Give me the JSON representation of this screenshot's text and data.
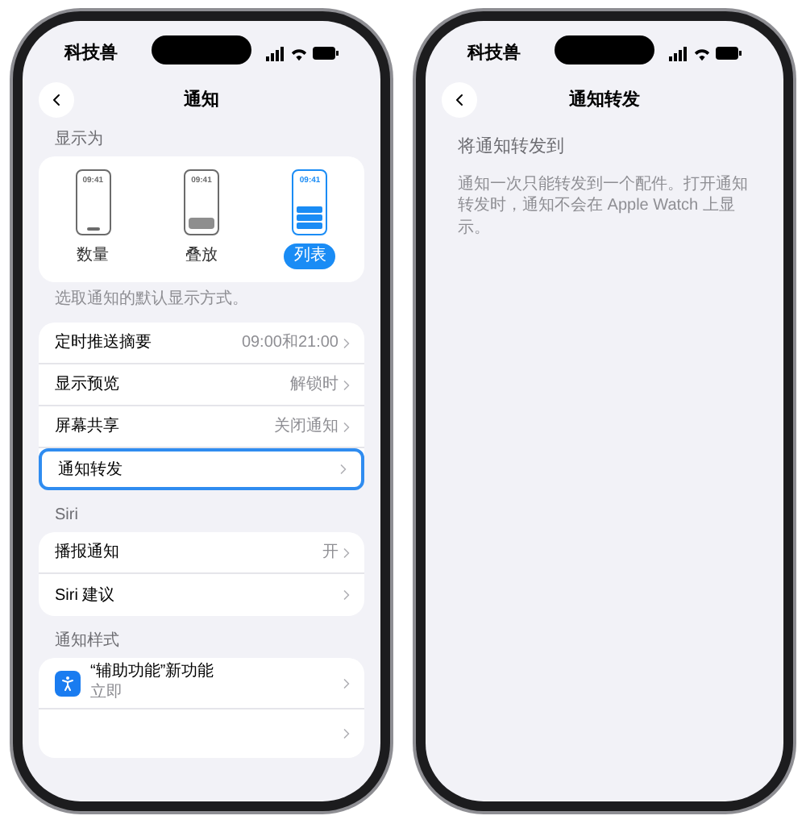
{
  "left_screen": {
    "status_bar": {
      "carrier": "科技兽"
    },
    "title": "通知",
    "display_section": {
      "header": "显示为",
      "options": [
        {
          "label": "数量",
          "clock": "09:41",
          "kind": "count",
          "selected": false
        },
        {
          "label": "叠放",
          "clock": "09:41",
          "kind": "stack",
          "selected": false
        },
        {
          "label": "列表",
          "clock": "09:41",
          "kind": "list",
          "selected": true
        }
      ],
      "footer": "选取通知的默认显示方式。"
    },
    "settings_rows": [
      {
        "label": "定时推送摘要",
        "value": "09:00和21:00",
        "selected": false
      },
      {
        "label": "显示预览",
        "value": "解锁时",
        "selected": false
      },
      {
        "label": "屏幕共享",
        "value": "关闭通知",
        "selected": false
      },
      {
        "label": "通知转发",
        "selected": true
      }
    ],
    "siri_section": {
      "header": "Siri",
      "rows": [
        {
          "label": "播报通知",
          "value": "开"
        },
        {
          "label": "Siri 建议"
        }
      ]
    },
    "style_section": {
      "header": "通知样式",
      "rows": [
        {
          "kind": "app",
          "title": "“辅助功能”新功能",
          "subtitle": "立即"
        },
        {
          "kind": "blank"
        }
      ]
    }
  },
  "right_screen": {
    "status_bar": {
      "carrier": "科技兽"
    },
    "title": "通知转发",
    "section_header": "将通知转发到",
    "description": "通知一次只能转发到一个配件。打开通知转发时，通知不会在 Apple Watch 上显示。"
  }
}
